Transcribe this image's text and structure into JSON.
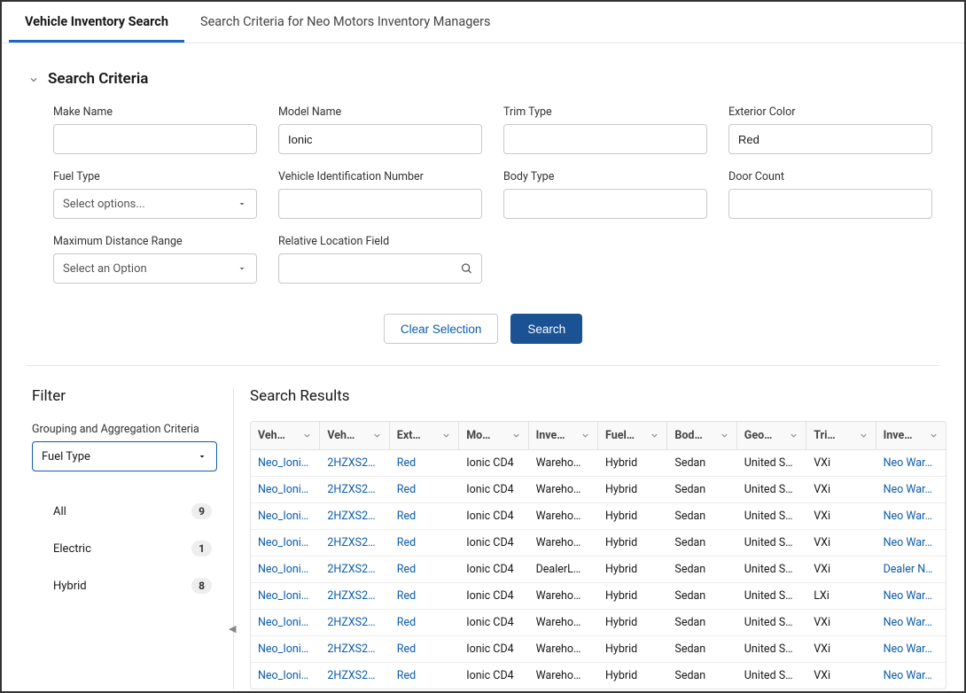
{
  "tabs": {
    "active": "Vehicle Inventory Search",
    "secondary": "Search Criteria for Neo Motors Inventory Managers"
  },
  "search_criteria": {
    "heading": "Search Criteria",
    "fields": {
      "make_name": {
        "label": "Make Name",
        "value": ""
      },
      "model_name": {
        "label": "Model Name",
        "value": "Ionic"
      },
      "trim_type": {
        "label": "Trim Type",
        "value": ""
      },
      "exterior_color": {
        "label": "Exterior Color",
        "value": "Red"
      },
      "fuel_type": {
        "label": "Fuel Type",
        "placeholder": "Select options..."
      },
      "vin": {
        "label": "Vehicle Identification Number",
        "value": ""
      },
      "body_type": {
        "label": "Body Type",
        "value": ""
      },
      "door_count": {
        "label": "Door Count",
        "value": ""
      },
      "max_distance": {
        "label": "Maximum Distance Range",
        "placeholder": "Select an Option"
      },
      "relative_location": {
        "label": "Relative Location Field",
        "value": ""
      }
    },
    "actions": {
      "clear": "Clear Selection",
      "search": "Search"
    }
  },
  "filter": {
    "heading": "Filter",
    "grouping_label": "Grouping and Aggregation Criteria",
    "grouping_value": "Fuel Type",
    "items": [
      {
        "label": "All",
        "count": "9"
      },
      {
        "label": "Electric",
        "count": "1"
      },
      {
        "label": "Hybrid",
        "count": "8"
      }
    ]
  },
  "results": {
    "heading": "Search Results",
    "columns": [
      "Veh…",
      "Veh…",
      "Ext…",
      "Mo…",
      "Inve…",
      "Fuel…",
      "Bod…",
      "Geo…",
      "Tri…",
      "Inve…"
    ],
    "link_cols": [
      0,
      1,
      2,
      9
    ],
    "rows": [
      [
        "Neo_Ioni…",
        "2HZXS2…",
        "Red",
        "Ionic CD4",
        "Wareho…",
        "Hybrid",
        "Sedan",
        "United S…",
        "VXi",
        "Neo War…"
      ],
      [
        "Neo_Ioni…",
        "2HZXS2…",
        "Red",
        "Ionic CD4",
        "Wareho…",
        "Hybrid",
        "Sedan",
        "United S…",
        "VXi",
        "Neo War…"
      ],
      [
        "Neo_Ioni…",
        "2HZXS2…",
        "Red",
        "Ionic CD4",
        "Wareho…",
        "Hybrid",
        "Sedan",
        "United S…",
        "VXi",
        "Neo War…"
      ],
      [
        "Neo_Ioni…",
        "2HZXS2…",
        "Red",
        "Ionic CD4",
        "Wareho…",
        "Hybrid",
        "Sedan",
        "United S…",
        "VXi",
        "Neo War…"
      ],
      [
        "Neo_Ioni…",
        "2HZXS2…",
        "Red",
        "Ionic CD4",
        "DealerL…",
        "Hybrid",
        "Sedan",
        "United S…",
        "VXi",
        "Dealer N…"
      ],
      [
        "Neo_Ioni…",
        "2HZXS2…",
        "Red",
        "Ionic CD4",
        "Wareho…",
        "Hybrid",
        "Sedan",
        "United S…",
        "LXi",
        "Neo War…"
      ],
      [
        "Neo_Ioni…",
        "2HZXS2…",
        "Red",
        "Ionic CD4",
        "Wareho…",
        "Hybrid",
        "Sedan",
        "United S…",
        "VXi",
        "Neo War…"
      ],
      [
        "Neo_Ioni…",
        "2HZXS2…",
        "Red",
        "Ionic CD4",
        "Wareho…",
        "Hybrid",
        "Sedan",
        "United S…",
        "VXi",
        "Neo War…"
      ],
      [
        "Neo_Ioni…",
        "2HZXS2…",
        "Red",
        "Ionic CD4",
        "Wareho…",
        "Hybrid",
        "Sedan",
        "United S…",
        "VXi",
        "Neo War…"
      ]
    ]
  }
}
